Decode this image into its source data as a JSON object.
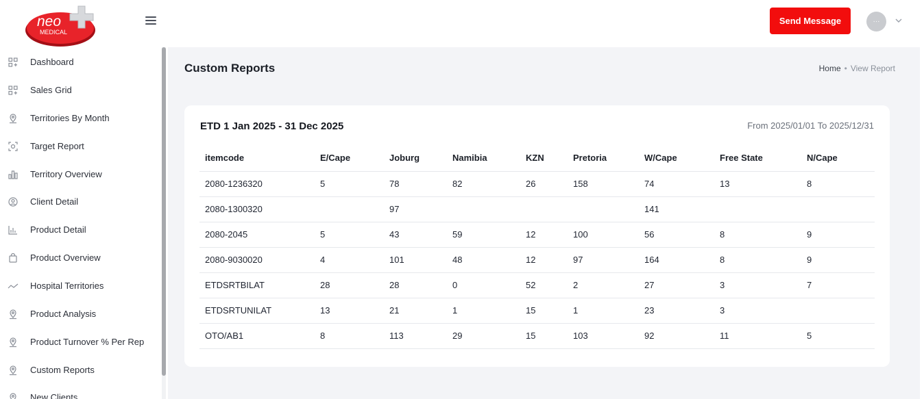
{
  "brand": {
    "name": "neo",
    "sub": "MEDICAL",
    "accent": "#e8232a"
  },
  "header": {
    "send_label": "Send Message",
    "avatar_initials": "···"
  },
  "sidebar": {
    "items": [
      {
        "label": "Dashboard",
        "icon": "grid-icon"
      },
      {
        "label": "Sales Grid",
        "icon": "grid-icon"
      },
      {
        "label": "Territories By Month",
        "icon": "map-pin-icon"
      },
      {
        "label": "Target Report",
        "icon": "target-icon"
      },
      {
        "label": "Territory Overview",
        "icon": "bar-chart-icon"
      },
      {
        "label": "Client Detail",
        "icon": "user-circle-icon"
      },
      {
        "label": "Product Detail",
        "icon": "bar-chart-icon"
      },
      {
        "label": "Product Overview",
        "icon": "bag-icon"
      },
      {
        "label": "Hospital Territories",
        "icon": "trend-icon"
      },
      {
        "label": "Product Analysis",
        "icon": "map-pin-icon"
      },
      {
        "label": "Product Turnover % Per Rep",
        "icon": "map-pin-icon"
      },
      {
        "label": "Custom Reports",
        "icon": "map-pin-icon"
      },
      {
        "label": "New Clients",
        "icon": "map-pin-icon"
      }
    ]
  },
  "page": {
    "title": "Custom Reports",
    "breadcrumb": {
      "home": "Home",
      "current": "View Report"
    }
  },
  "report": {
    "title": "ETD 1 Jan 2025 - 31 Dec 2025",
    "range": "From 2025/01/01 To 2025/12/31",
    "columns": [
      "itemcode",
      "E/Cape",
      "Joburg",
      "Namibia",
      "KZN",
      "Pretoria",
      "W/Cape",
      "Free State",
      "N/Cape"
    ],
    "rows": [
      [
        "2080-1236320",
        "5",
        "78",
        "82",
        "26",
        "158",
        "74",
        "13",
        "8"
      ],
      [
        "2080-1300320",
        "",
        "97",
        "",
        "",
        "",
        "141",
        "",
        ""
      ],
      [
        "2080-2045",
        "5",
        "43",
        "59",
        "12",
        "100",
        "56",
        "8",
        "9"
      ],
      [
        "2080-9030020",
        "4",
        "101",
        "48",
        "12",
        "97",
        "164",
        "8",
        "9"
      ],
      [
        "ETDSRTBILAT",
        "28",
        "28",
        "0",
        "52",
        "2",
        "27",
        "3",
        "7"
      ],
      [
        "ETDSRTUNILAT",
        "13",
        "21",
        "1",
        "15",
        "1",
        "23",
        "3",
        ""
      ],
      [
        "OTO/AB1",
        "8",
        "113",
        "29",
        "15",
        "103",
        "92",
        "11",
        "5"
      ]
    ]
  }
}
